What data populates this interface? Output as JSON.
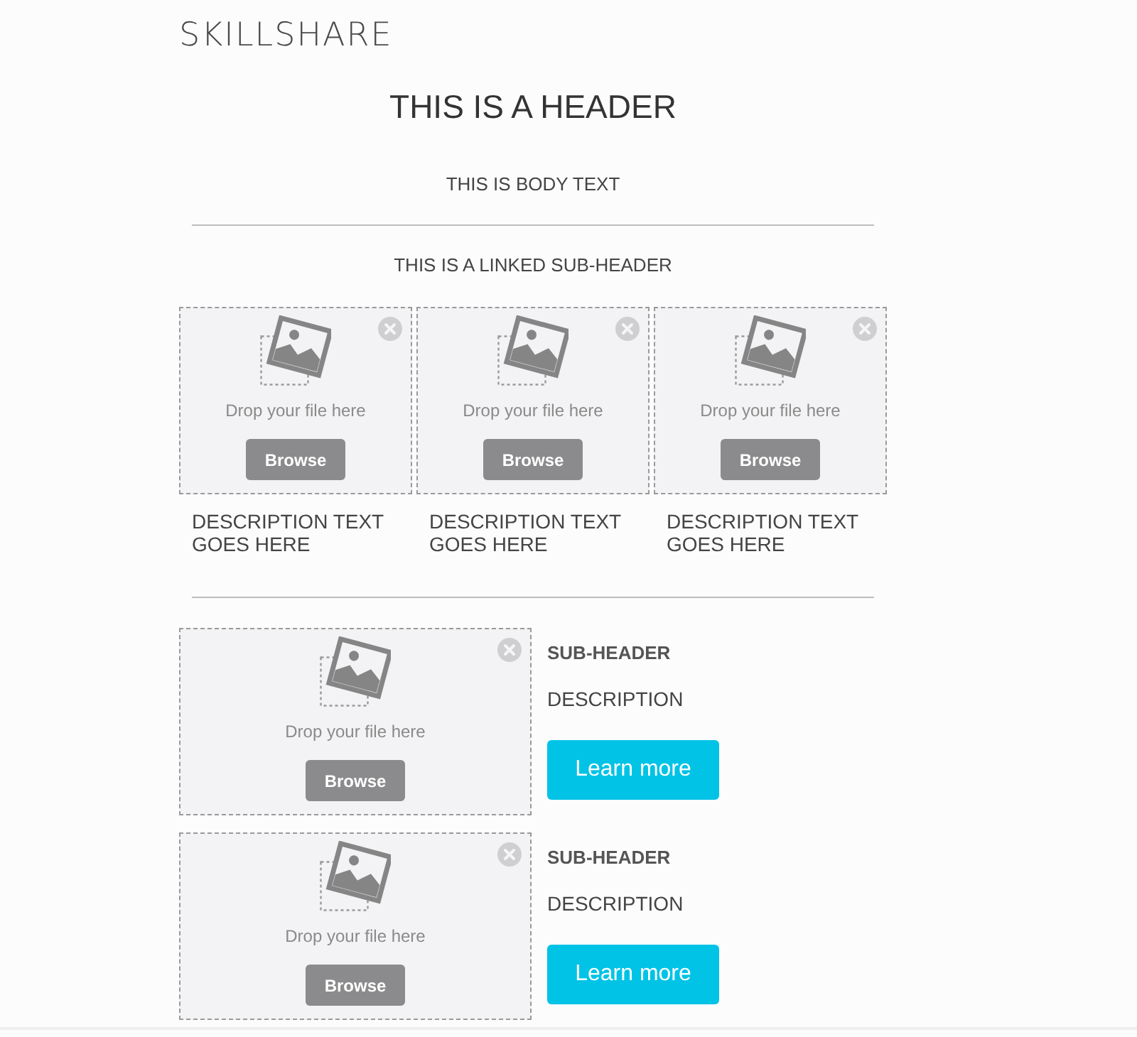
{
  "logo": {
    "text": "SKILLSHARE"
  },
  "header": "THIS IS A HEADER",
  "body_text": "THIS IS BODY TEXT",
  "linked_subheader": "THIS IS A LINKED SUB-HEADER",
  "gallery": [
    {
      "dropzone": {
        "prompt": "Drop your file here",
        "button": "Browse"
      },
      "description": "DESCRIPTION TEXT GOES HERE"
    },
    {
      "dropzone": {
        "prompt": "Drop your file here",
        "button": "Browse"
      },
      "description": "DESCRIPTION TEXT GOES HERE"
    },
    {
      "dropzone": {
        "prompt": "Drop your file here",
        "button": "Browse"
      },
      "description": "DESCRIPTION TEXT GOES HERE"
    }
  ],
  "features": [
    {
      "dropzone": {
        "prompt": "Drop your file here",
        "button": "Browse"
      },
      "subheader": "SUB-HEADER",
      "description": "DESCRIPTION",
      "button": "Learn more"
    },
    {
      "dropzone": {
        "prompt": "Drop your file here",
        "button": "Browse"
      },
      "subheader": "SUB-HEADER",
      "description": "DESCRIPTION",
      "button": "Learn more"
    }
  ]
}
